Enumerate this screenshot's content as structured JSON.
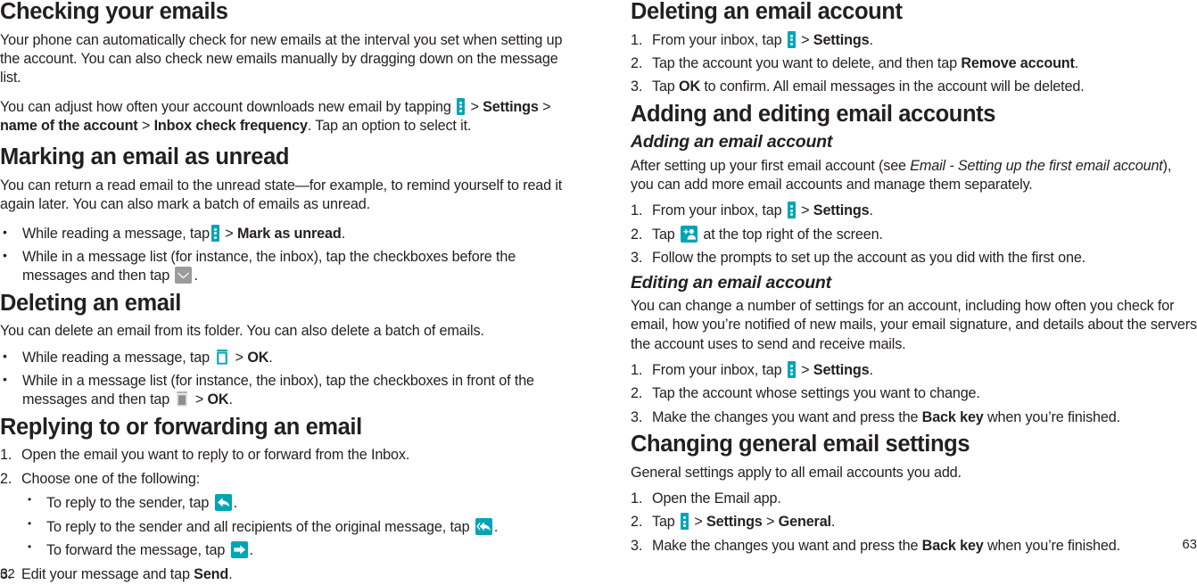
{
  "document": {
    "left_page_number": "62",
    "right_page_number": "63"
  },
  "colors": {
    "teal_accent": "#00a5b5",
    "gray_icon": "#9b9b9b",
    "text": "#231f20"
  },
  "icons": {
    "overflow_menu": "overflow-menu-icon",
    "envelope": "envelope-icon",
    "trash_teal": "trash-icon",
    "trash_gray": "trash-icon",
    "reply": "reply-arrow-icon",
    "reply_all": "reply-all-arrow-icon",
    "forward": "forward-arrow-icon",
    "add_account": "add-account-icon"
  },
  "left_column": {
    "checking_emails": {
      "title": "Checking your emails",
      "para1": "Your phone can automatically check for new emails at the interval you set when setting up the account. You can also check new emails manually by dragging down on the message list.",
      "para2_a": "You can adjust how often your account downloads new email by tapping ",
      "para2_b": " > ",
      "para2_settings": "Settings",
      "para2_c": " > ",
      "para2_account": "name of the account",
      "para2_d": " > ",
      "para2_freq": "Inbox check frequency",
      "para2_e": ". Tap an option to select it."
    },
    "marking_unread": {
      "title": "Marking an email as unread",
      "para1": "You can return a read email to the unread state—for example, to remind yourself to read it again later. You can also mark a batch of emails as unread.",
      "bullet1_a": "While reading a message, tap",
      "bullet1_b": " > ",
      "bullet1_bold": "Mark as unread",
      "bullet1_c": ".",
      "bullet2_a": "While in a message list (for instance, the inbox), tap the checkboxes before the messages and then tap ",
      "bullet2_b": "."
    },
    "deleting_email": {
      "title": "Deleting an email",
      "para1": "You can delete an email from its folder. You can also delete a batch of emails.",
      "bullet1_a": "While reading a message, tap ",
      "bullet1_b": " > ",
      "bullet1_bold": "OK",
      "bullet1_c": ".",
      "bullet2_a": "While in a message list (for instance, the inbox), tap the checkboxes in front of the messages and then tap ",
      "bullet2_b": " > ",
      "bullet2_bold": "OK",
      "bullet2_c": "."
    },
    "replying": {
      "title": "Replying to or forwarding an email",
      "step1_num": "1.",
      "step1": "Open the email you want to reply to or forward from the Inbox.",
      "step2_num": "2.",
      "step2": "Choose one of the following:",
      "sub1_a": "To reply to the sender, tap ",
      "sub1_b": ".",
      "sub2_a": "To reply to the sender and all recipients of the original message, tap ",
      "sub2_b": ".",
      "sub3_a": "To forward the message, tap ",
      "sub3_b": ".",
      "step3_num": "3.",
      "step3_a": "Edit your message and tap ",
      "step3_bold": "Send",
      "step3_b": "."
    }
  },
  "right_column": {
    "deleting_account": {
      "title": "Deleting an email account",
      "step1_num": "1.",
      "step1_a": "From your inbox, tap ",
      "step1_b": " > ",
      "step1_bold": "Settings",
      "step1_c": ".",
      "step2_num": "2.",
      "step2_a": "Tap the account you want to delete, and then tap ",
      "step2_bold": "Remove account",
      "step2_b": ".",
      "step3_num": "3.",
      "step3_a": "Tap ",
      "step3_bold": "OK",
      "step3_b": " to confirm. All email messages in the account will be deleted."
    },
    "adding_editing": {
      "title": "Adding and editing email accounts",
      "adding": {
        "subtitle": "Adding an email account",
        "para1_a": "After setting up your first email account (see ",
        "para1_italic": "Email - Setting up the first email account",
        "para1_b": "), you can add more email accounts and manage them separately.",
        "step1_num": "1.",
        "step1_a": "From your inbox, tap ",
        "step1_b": " > ",
        "step1_bold": "Settings",
        "step1_c": ".",
        "step2_num": "2.",
        "step2_a": "Tap ",
        "step2_b": " at the top right of the screen.",
        "step3_num": "3.",
        "step3": "Follow the prompts to set up the account as you did with the first one."
      },
      "editing": {
        "subtitle": "Editing an email account",
        "para1": "You can change a number of settings for an account, including how often you check for email, how you’re notified of new mails, your email signature, and details about the servers the account uses to send and receive mails.",
        "step1_num": "1.",
        "step1_a": "From your inbox, tap ",
        "step1_b": " > ",
        "step1_bold": "Settings",
        "step1_c": ".",
        "step2_num": "2.",
        "step2": "Tap the account whose settings you want to change.",
        "step3_num": "3.",
        "step3_a": "Make the changes you want and press the ",
        "step3_bold": "Back key",
        "step3_b": " when you’re finished."
      }
    },
    "general_settings": {
      "title": "Changing general email settings",
      "para1": "General settings apply to all email accounts you add.",
      "step1_num": "1.",
      "step1": "Open the Email app.",
      "step2_num": "2.",
      "step2_a": "Tap ",
      "step2_b": " > ",
      "step2_bold1": "Settings",
      "step2_c": " > ",
      "step2_bold2": "General",
      "step2_d": ".",
      "step3_num": "3.",
      "step3_a": "Make the changes you want and press the ",
      "step3_bold": "Back key",
      "step3_b": " when you’re finished."
    }
  }
}
